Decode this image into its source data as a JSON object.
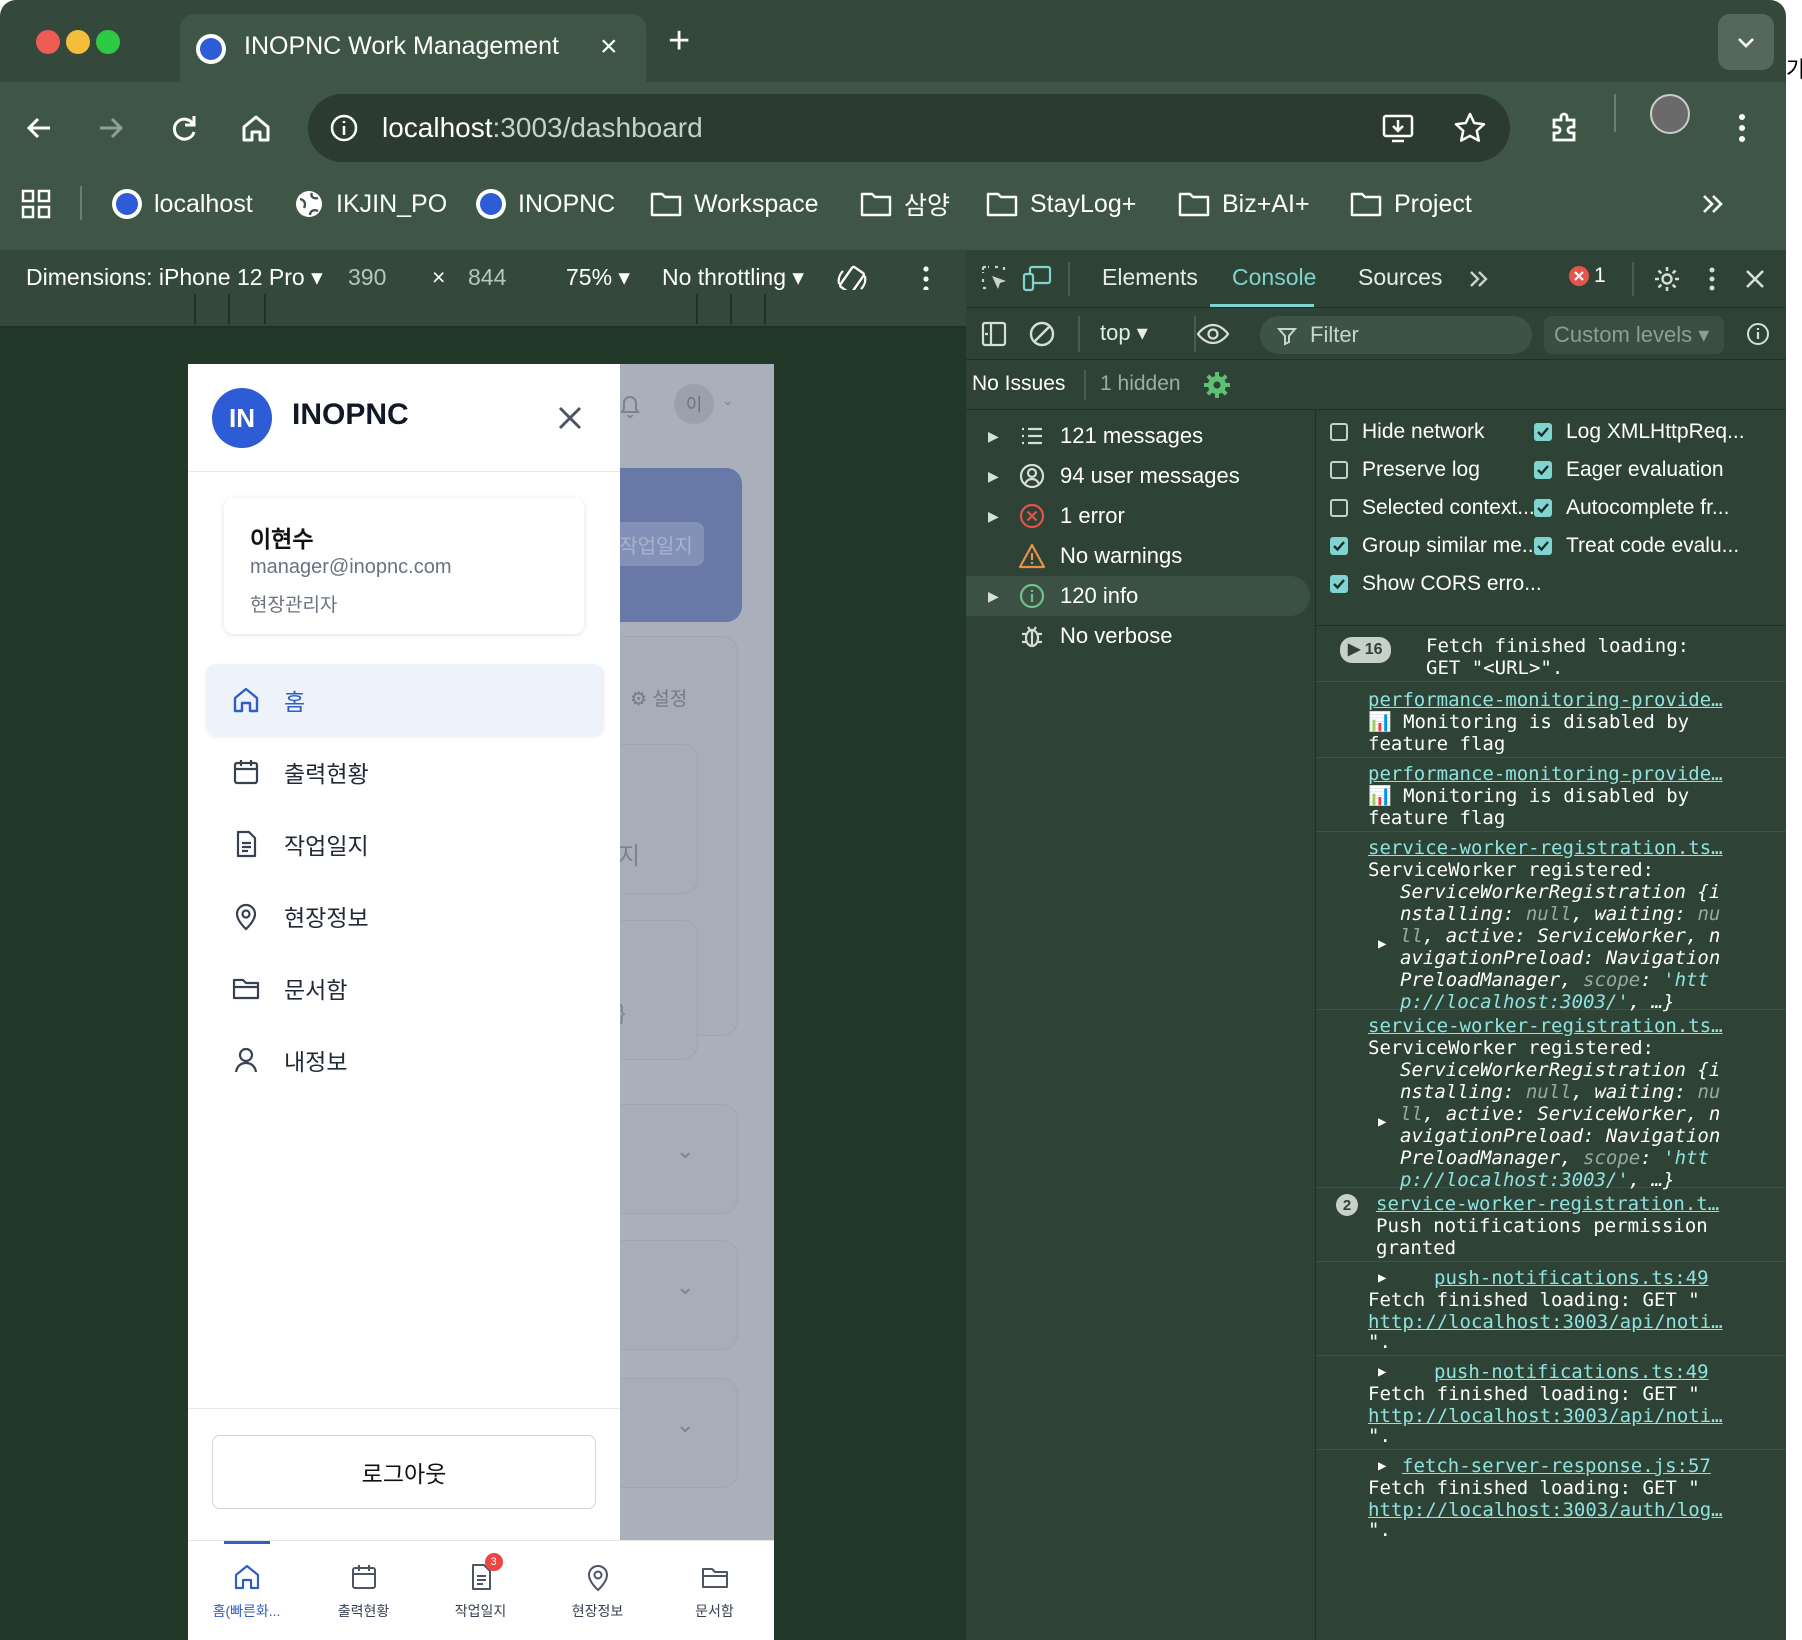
{
  "browser": {
    "tab_title": "INOPNC Work Management",
    "url_host": "localhost",
    "url_path": ":3003/dashboard",
    "bookmarks": [
      "localhost",
      "IKJIN_PO",
      "INOPNC",
      "Workspace",
      "삼양",
      "StayLog+",
      "Biz+AI+",
      "Project"
    ],
    "edge_text": "가"
  },
  "device_toolbar": {
    "dimensions": "Dimensions: iPhone 12 Pro",
    "width": "390",
    "times": "×",
    "height": "844",
    "zoom": "75%",
    "throttling": "No throttling"
  },
  "app": {
    "brand": "INOPNC",
    "logo_text": "IN",
    "profile": {
      "name": "이현수",
      "email": "manager@inopnc.com",
      "role": "현장관리자"
    },
    "menu": [
      {
        "label": "홈",
        "icon": "home-icon"
      },
      {
        "label": "출력현황",
        "icon": "calendar-icon"
      },
      {
        "label": "작업일지",
        "icon": "document-icon"
      },
      {
        "label": "현장정보",
        "icon": "map-pin-icon"
      },
      {
        "label": "문서함",
        "icon": "folder-icon"
      },
      {
        "label": "내정보",
        "icon": "user-icon"
      }
    ],
    "logout": "로그아웃",
    "bg": {
      "avatar": "이",
      "chip": "작업일지",
      "settings": "⚙ 설정",
      "frag1": "지",
      "frag2": "}"
    },
    "bottom_nav": [
      {
        "label": "홈(빠른화...",
        "icon": "home-icon"
      },
      {
        "label": "출력현황",
        "icon": "calendar-icon"
      },
      {
        "label": "작업일지",
        "icon": "document-icon",
        "badge": "3"
      },
      {
        "label": "현장정보",
        "icon": "map-pin-icon"
      },
      {
        "label": "문서함",
        "icon": "folder-icon"
      }
    ],
    "accent": "#2f5ec4"
  },
  "devtools": {
    "tabs": [
      "Elements",
      "Console",
      "Sources"
    ],
    "error_count": "1",
    "context": "top",
    "filter": "Filter",
    "levels": "Custom levels",
    "issues": "No Issues",
    "hidden": "1 hidden",
    "groups": [
      {
        "label": "121 messages",
        "icon": "list-icon"
      },
      {
        "label": "94 user messages",
        "icon": "user-circle-icon"
      },
      {
        "label": "1 error",
        "icon": "error-icon"
      },
      {
        "label": "No warnings",
        "icon": "warning-icon"
      },
      {
        "label": "120 info",
        "icon": "info-icon"
      },
      {
        "label": "No verbose",
        "icon": "bug-icon"
      }
    ],
    "settings": [
      {
        "label": "Hide network",
        "checked": false
      },
      {
        "label": "Log XMLHttpReq...",
        "checked": true
      },
      {
        "label": "Preserve log",
        "checked": false
      },
      {
        "label": "Eager evaluation",
        "checked": true
      },
      {
        "label": "Selected context...",
        "checked": false
      },
      {
        "label": "Autocomplete fr...",
        "checked": true
      },
      {
        "label": "Group similar me...",
        "checked": true
      },
      {
        "label": "Treat code evalu...",
        "checked": true
      },
      {
        "label": "Show CORS erro...",
        "checked": true
      }
    ],
    "log": {
      "m1_count": "16",
      "m1_l1": "Fetch finished loading:",
      "m1_l2": "GET \"<URL>\".",
      "m2_link": "performance-monitoring-provide…",
      "m2_l1": "📊 Monitoring is disabled by",
      "m2_l2": "feature flag",
      "m3_link": "performance-monitoring-provide…",
      "m3_l1": "📊 Monitoring is disabled by",
      "m3_l2": "feature flag",
      "sw_link": "service-worker-registration.ts…",
      "sw_l1": "ServiceWorker registered:",
      "sw_o1": "ServiceWorkerRegistration {i",
      "sw_o2a": "nstalling: ",
      "sw_o2b": "null",
      "sw_o2c": ", waiting: ",
      "sw_o2d": "nu",
      "sw_o3a": "ll",
      "sw_o3b": ", active: ServiceWorker, n",
      "sw_o4": "avigationPreload: Navigation",
      "sw_o5a": "PreloadManager, ",
      "sw_o5b": "scope",
      "sw_o5c": ": ",
      "sw_o5d": "'htt",
      "sw_o6a": "p://localhost:3003/'",
      "sw_o6b": ", …}",
      "m6_count": "2",
      "m6_link": "service-worker-registration.t…",
      "m6_l1": "Push notifications permission",
      "m6_l2": "granted",
      "m7_link": "push-notifications.ts:49",
      "m7_l1": "Fetch finished loading: GET \"",
      "m7_l2": "http://localhost:3003/api/noti…",
      "m7_l3": "\".",
      "m8_link": "push-notifications.ts:49",
      "m8_l1": "Fetch finished loading: GET \"",
      "m8_l2": "http://localhost:3003/api/noti…",
      "m8_l3": "\".",
      "m9_link": "fetch-server-response.js:57",
      "m9_l1": "Fetch finished loading: GET \"",
      "m9_l2": "http://localhost:3003/auth/log…",
      "m9_l3": "\"."
    }
  }
}
